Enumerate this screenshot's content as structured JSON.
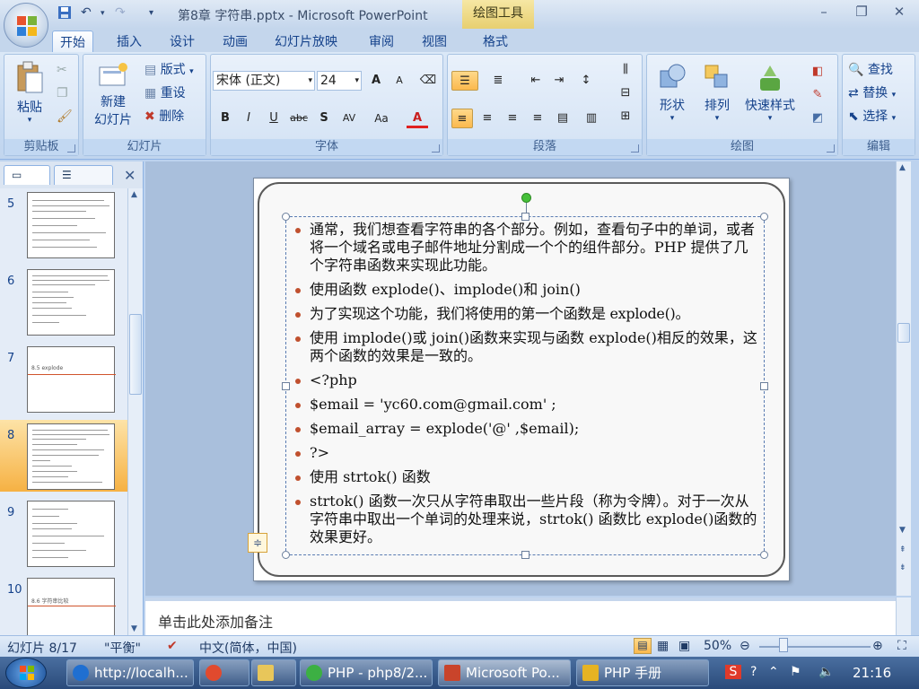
{
  "window": {
    "title": "第8章 字符串.pptx - Microsoft PowerPoint",
    "context_tab_title": "绘图工具"
  },
  "ribbon": {
    "tabs": [
      "开始",
      "插入",
      "设计",
      "动画",
      "幻灯片放映",
      "审阅",
      "视图",
      "格式"
    ],
    "clipboard": {
      "paste": "粘贴",
      "group": "剪贴板"
    },
    "slides": {
      "new_slide_line1": "新建",
      "new_slide_line2": "幻灯片",
      "layout": "版式",
      "reset": "重设",
      "delete": "删除",
      "group": "幻灯片"
    },
    "font": {
      "name": "宋体 (正文)",
      "size": "24",
      "group": "字体",
      "bold": "B",
      "italic": "I",
      "underline": "U",
      "strike": "abc",
      "shadow": "S",
      "spacing": "AV",
      "case": "Aa",
      "color": "A",
      "grow": "A",
      "shrink": "A"
    },
    "paragraph": {
      "group": "段落"
    },
    "drawing": {
      "shapes": "形状",
      "arrange": "排列",
      "quick_styles": "快速样式",
      "group": "绘图"
    },
    "editing": {
      "find": "查找",
      "replace": "替换",
      "select": "选择",
      "group": "编辑"
    },
    "accent_color": "#f6b143"
  },
  "thumbnails": [
    {
      "num": "5",
      "title": ""
    },
    {
      "num": "6",
      "title": ""
    },
    {
      "num": "7",
      "title": "8.5 explode"
    },
    {
      "num": "8",
      "title": ""
    },
    {
      "num": "9",
      "title": ""
    },
    {
      "num": "10",
      "title": "8.6 字符串比较"
    }
  ],
  "slide": {
    "bullets": [
      "通常，我们想查看字符串的各个部分。例如，查看句子中的单词，或者将一个域名或电子邮件地址分割成一个个的组件部分。PHP 提供了几个字符串函数来实现此功能。",
      "使用函数 explode()、implode()和 join()",
      "为了实现这个功能，我们将使用的第一个函数是 explode()。",
      "使用 implode()或 join()函数来实现与函数 explode()相反的效果，这两个函数的效果是一致的。",
      "<?php",
      "$email = 'yc60.com@gmail.com' ;",
      "$email_array = explode('@' ,$email);",
      "?>",
      "使用 strtok() 函数",
      "strtok() 函数一次只从字符串取出一些片段（称为令牌）。对于一次从字符串中取出一个单词的处理来说，strtok() 函数比 explode()函数的效果更好。"
    ],
    "bullet_color": "#c0502e"
  },
  "notes": {
    "placeholder": "单击此处添加备注"
  },
  "status": {
    "slide_info": "幻灯片 8/17",
    "theme": "\"平衡\"",
    "language": "中文(简体，中国)",
    "zoom": "50%"
  },
  "taskbar": {
    "items": [
      {
        "label": "http://localh...",
        "color": "#1f6fd1"
      },
      {
        "label": "",
        "color": "#e14a2e"
      },
      {
        "label": "",
        "color": "#e8c65a"
      },
      {
        "label": "PHP - php8/2...",
        "color": "#3cb043"
      },
      {
        "label": "Microsoft Po...",
        "color": "#c9442b"
      },
      {
        "label": "PHP 手册",
        "color": "#e6b323"
      }
    ],
    "time": "21:16"
  }
}
